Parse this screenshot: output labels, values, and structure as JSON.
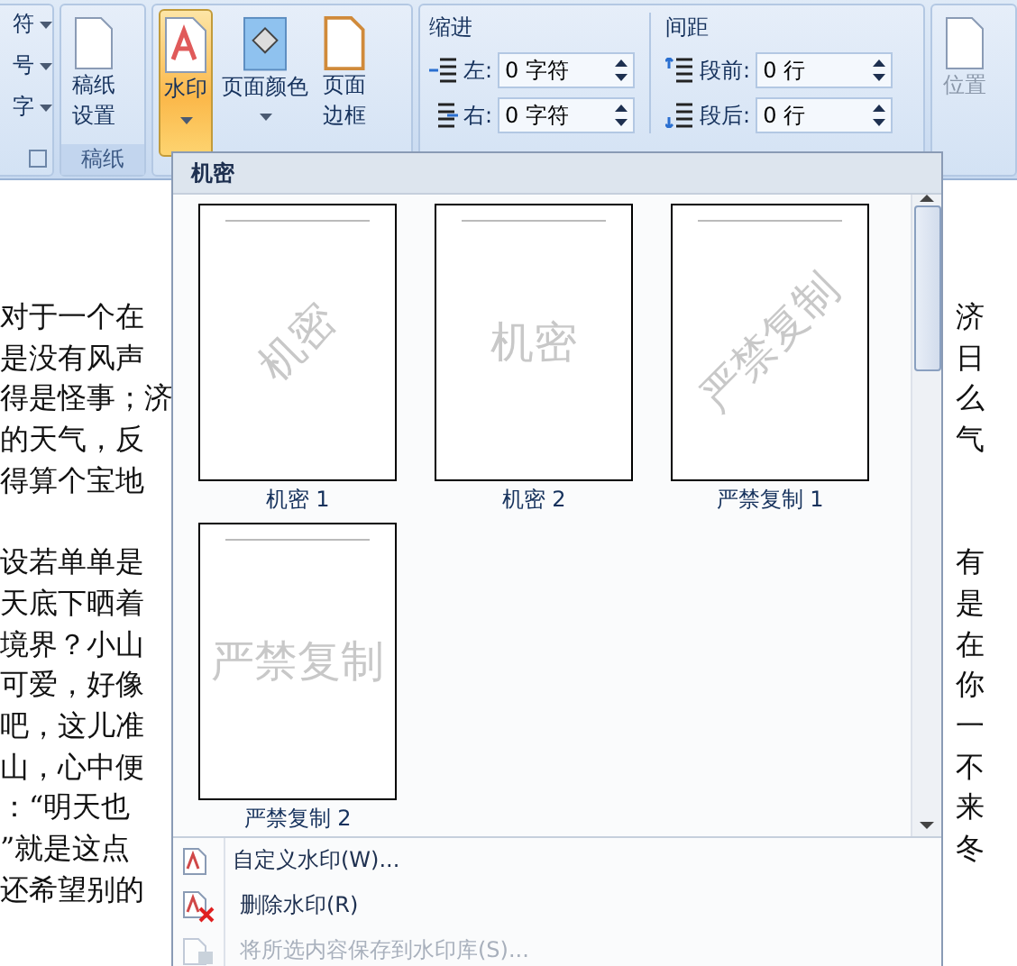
{
  "ribbon": {
    "partial_group": {
      "items": [
        "符",
        "号",
        "字"
      ]
    },
    "paper_group": {
      "button": {
        "line1": "稿纸",
        "line2": "设置"
      },
      "label": "稿纸"
    },
    "background_group": {
      "buttons": [
        {
          "kind": "watermark",
          "line1": "水印",
          "selected": true
        },
        {
          "kind": "color",
          "line1": "页面颜色",
          "selected": false
        },
        {
          "kind": "border",
          "line1": "页面",
          "line2": "边框",
          "selected": false
        }
      ]
    },
    "indent": {
      "title": "缩进",
      "fields": [
        {
          "kind": "left",
          "label": "左:",
          "value": "0 字符"
        },
        {
          "kind": "right",
          "label": "右:",
          "value": "0 字符"
        }
      ]
    },
    "spacing": {
      "title": "间距",
      "fields": [
        {
          "kind": "before",
          "label": "段前:",
          "value": "0 行"
        },
        {
          "kind": "after",
          "label": "段后:",
          "value": "0 行"
        }
      ]
    },
    "arrange": {
      "button": "位置",
      "disabled": true
    }
  },
  "document": {
    "paragraphs": [
      {
        "lines": [
          {
            "left": "对于一个在",
            "right": "济"
          },
          {
            "left": "是没有风声",
            "right": "日"
          },
          {
            "left": "得是怪事；济",
            "right": "么"
          },
          {
            "left": "的天气，反",
            "right": "气"
          },
          {
            "left": "得算个宝地"
          }
        ]
      },
      {
        "lines": [
          {
            "left": "设若单单是",
            "right": "有"
          },
          {
            "left": "天底下晒着",
            "right": "是"
          },
          {
            "left": "境界？小山",
            "right": "在"
          },
          {
            "left": "可爱，好像",
            "right": "你"
          },
          {
            "left": "吧，这儿准",
            "right": "一"
          },
          {
            "left": "山，心中便",
            "right": "不"
          },
          {
            "left": "：“明天也",
            "right": "来"
          },
          {
            "left": "”就是这点",
            "right": "冬"
          },
          {
            "left": "还希望别的"
          }
        ]
      }
    ]
  },
  "watermark_menu": {
    "section": "机密",
    "gallery": [
      {
        "text": "机密",
        "kind": "diagonal",
        "caption": "机密 1"
      },
      {
        "text": "机密",
        "kind": "horizontal",
        "caption": "机密 2"
      },
      {
        "text": "严禁复制",
        "kind": "diagonal",
        "caption": "严禁复制 1"
      },
      {
        "text": "严禁复制",
        "kind": "horizontal",
        "caption": "严禁复制 2"
      }
    ],
    "items": [
      {
        "kind": "custom",
        "label": "自定义水印(W)...",
        "disabled": false
      },
      {
        "kind": "remove",
        "label": "删除水印(R)",
        "disabled": false
      },
      {
        "kind": "save",
        "label": "将所选内容保存到水印库(S)...",
        "disabled": true
      }
    ]
  }
}
